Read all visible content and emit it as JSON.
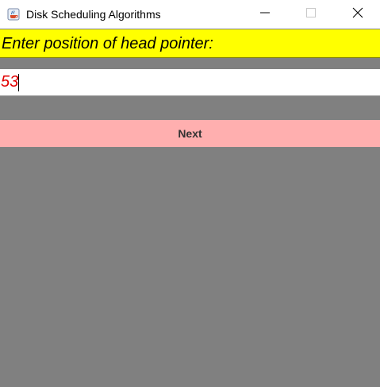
{
  "window": {
    "title": "Disk Scheduling Algorithms",
    "icon": "java-coffee-cup-icon",
    "controls": {
      "minimize_icon": "minimize-icon",
      "maximize_icon": "maximize-icon",
      "close_icon": "close-icon"
    }
  },
  "form": {
    "prompt_label": "Enter position of head pointer:",
    "head_input_value": "53",
    "next_button_label": "Next"
  },
  "colors": {
    "label_background": "#ffff00",
    "input_text": "#e00000",
    "button_background": "#ffafaf",
    "panel_background": "#808080"
  }
}
